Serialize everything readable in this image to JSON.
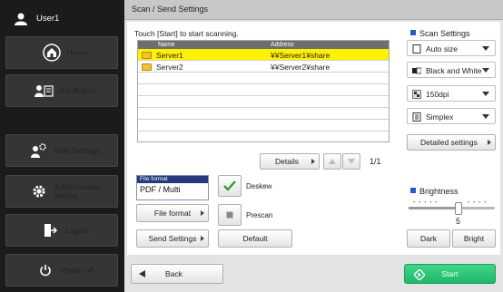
{
  "sidebar": {
    "user": "User1",
    "home": "Home",
    "job_button": "Job Button",
    "user_settings": "User Settings",
    "admin_line1": "Administrator",
    "admin_line2": "setting",
    "logout": "Logout",
    "power_off": "Power off"
  },
  "header": {
    "title": "Scan / Send Settings"
  },
  "hint": "Touch [Start] to start scanning.",
  "destinations": {
    "columns": {
      "name": "Name",
      "address": "Address"
    },
    "rows": [
      {
        "name": "Server1",
        "address": "¥¥Server1¥share",
        "selected": true
      },
      {
        "name": "Server2",
        "address": "¥¥Server2¥share",
        "selected": false
      }
    ],
    "page": "1/1"
  },
  "buttons": {
    "details": "Details",
    "detailed_settings": "Detailed settings",
    "file_format": "File format",
    "send_settings": "Send Settings",
    "default": "Default",
    "back": "Back",
    "start": "Start",
    "dark": "Dark",
    "bright": "Bright"
  },
  "file_format": {
    "label": "File format",
    "value": "PDF / Multi"
  },
  "options": {
    "deskew": {
      "label": "Deskew",
      "checked": true
    },
    "prescan": {
      "label": "Prescan",
      "checked": false
    }
  },
  "scan_settings": {
    "title": "Scan Settings",
    "size": "Auto size",
    "color": "Black and White",
    "resolution": "150dpi",
    "sides": "Simplex"
  },
  "brightness": {
    "title": "Brightness",
    "value": "5",
    "level": 5,
    "max": 9
  },
  "colors": {
    "accent": "#2a58c8",
    "selected_row": "#fff200",
    "start": "#21b76a",
    "check": "#2e9b3a"
  }
}
